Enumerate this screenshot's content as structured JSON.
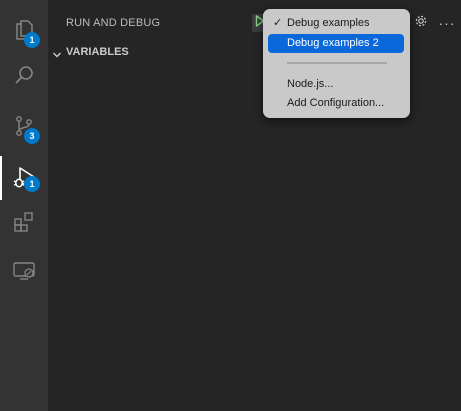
{
  "activity_bar": {
    "items": [
      {
        "name": "explorer",
        "icon": "files-icon",
        "badge": "1"
      },
      {
        "name": "search",
        "icon": "search-icon",
        "badge": ""
      },
      {
        "name": "source-control",
        "icon": "source-control-icon",
        "badge": "3"
      },
      {
        "name": "run-and-debug",
        "icon": "debug-icon",
        "badge": "1"
      },
      {
        "name": "extensions",
        "icon": "extensions-icon",
        "badge": ""
      },
      {
        "name": "remote-explorer",
        "icon": "remote-explorer-icon",
        "badge": ""
      }
    ],
    "badge_color": "#007acc"
  },
  "sidebar": {
    "title": "RUN AND DEBUG",
    "start_icon": "play-icon",
    "settings_icon": "gear-icon",
    "more_icon": "ellipsis-icon",
    "more_label": "···",
    "sections": [
      {
        "label": "VARIABLES",
        "expanded": true
      }
    ]
  },
  "dropdown": {
    "items": [
      {
        "label": "Debug examples",
        "checked": true,
        "selected": false
      },
      {
        "label": "Debug examples 2",
        "checked": false,
        "selected": true
      },
      {
        "label": "Node.js...",
        "checked": false,
        "selected": false
      },
      {
        "label": "Add Configuration...",
        "checked": false,
        "selected": false
      }
    ],
    "check_mark": "✓",
    "highlight_color": "#0a68da"
  }
}
